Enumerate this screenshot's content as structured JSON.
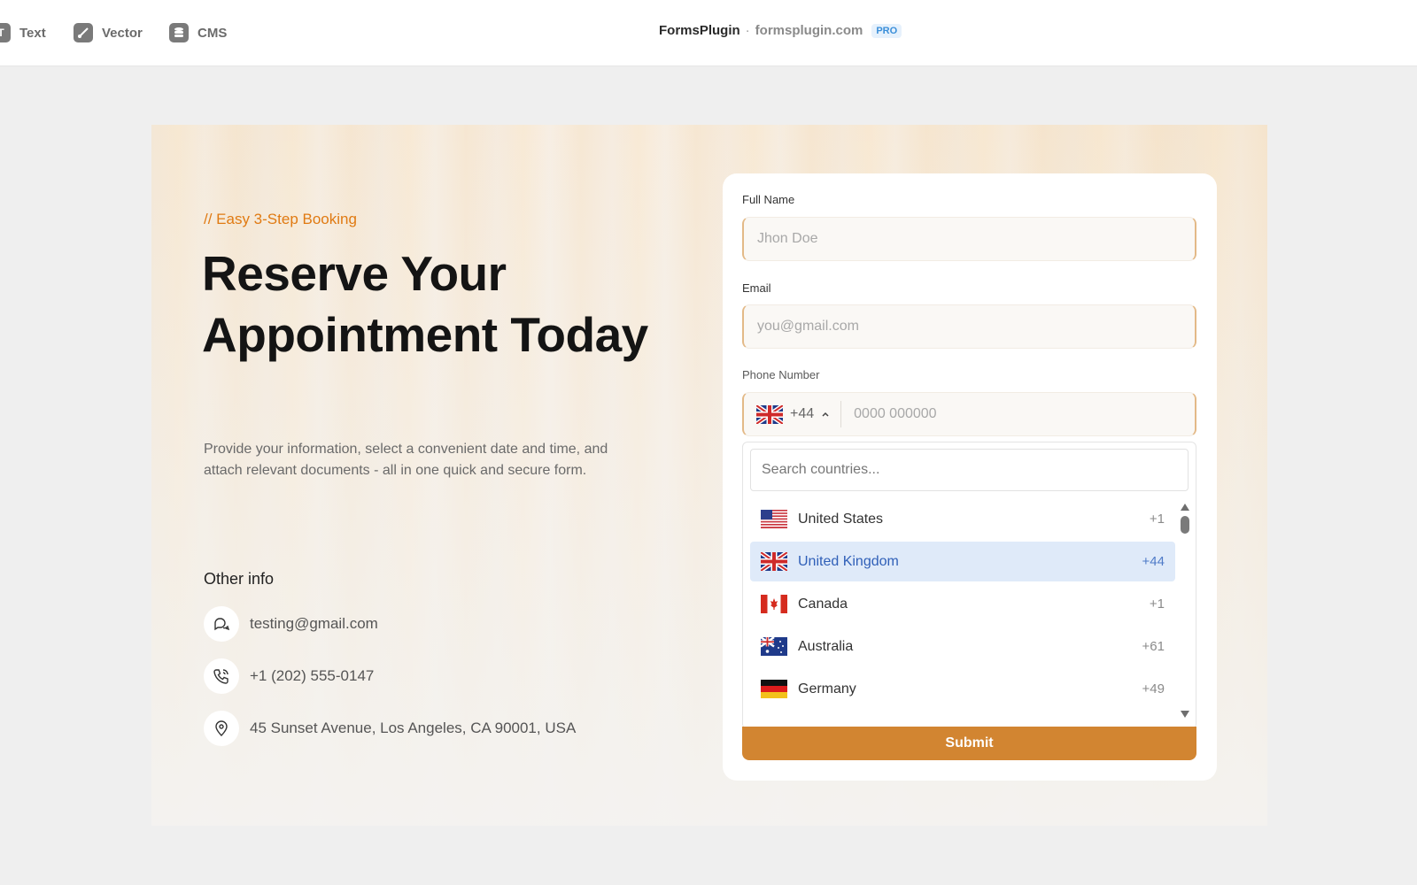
{
  "toolbar": {
    "items": [
      {
        "label": "Text",
        "icon": "text-icon"
      },
      {
        "label": "Vector",
        "icon": "vector-icon"
      },
      {
        "label": "CMS",
        "icon": "database-icon"
      }
    ],
    "brand": {
      "name": "FormsPlugin",
      "separator": "·",
      "url": "formsplugin.com",
      "badge": "PRO"
    }
  },
  "hero": {
    "kicker": "// Easy 3-Step Booking",
    "headline": "Reserve Your Appointment Today",
    "lead": "Provide your information, select a convenient date and time, and attach relevant documents - all in one quick and secure form.",
    "other_info_title": "Other info",
    "contacts": {
      "email": "testing@gmail.com",
      "phone": "+1 (202) 555-0147",
      "address": "45 Sunset Avenue, Los Angeles, CA 90001, USA"
    }
  },
  "form": {
    "full_name": {
      "label": "Full Name",
      "placeholder": "Jhon Doe"
    },
    "email": {
      "label": "Email",
      "placeholder": "you@gmail.com"
    },
    "phone": {
      "label": "Phone Number",
      "country_code": "+44",
      "placeholder": "0000 000000"
    },
    "country_search": {
      "placeholder": "Search countries..."
    },
    "countries": [
      {
        "name": "United States",
        "code": "+1",
        "flag": "us-flag-icon"
      },
      {
        "name": "United Kingdom",
        "code": "+44",
        "flag": "uk-flag-icon",
        "selected": true
      },
      {
        "name": "Canada",
        "code": "+1",
        "flag": "canada-flag-icon"
      },
      {
        "name": "Australia",
        "code": "+61",
        "flag": "australia-flag-icon"
      },
      {
        "name": "Germany",
        "code": "+49",
        "flag": "germany-flag-icon"
      }
    ],
    "submit_label": "Submit"
  },
  "colors": {
    "accent": "#e07a12",
    "submit": "#d28531",
    "selected_row": "#dfeaf9"
  }
}
